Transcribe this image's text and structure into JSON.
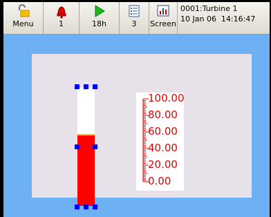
{
  "toolbar": {
    "menu_label": "Menu",
    "alarms_label": "1",
    "duration_label": "18h",
    "pages_label": "3",
    "screen_label": "Screen"
  },
  "status": {
    "device": "0001:Turbine 1",
    "datetime": "10 Jan 06  14:16:47"
  },
  "bar": {
    "level_percent": 60.0,
    "scale_labels": [
      "100.00",
      "80.00",
      "60.00",
      "40.00",
      "20.00",
      "0.00"
    ]
  },
  "colors": {
    "background": "#6db1f4",
    "panel": "#e7e1ea",
    "fill": "#ff0000",
    "scale_text": "#e00000",
    "handles": "#0000ff"
  },
  "icons": {
    "menu": "padlock-icon",
    "alarms": "alarm-bell-icon",
    "duration": "play-icon",
    "pages": "list-icon",
    "screen": "screen-chart-icon"
  }
}
